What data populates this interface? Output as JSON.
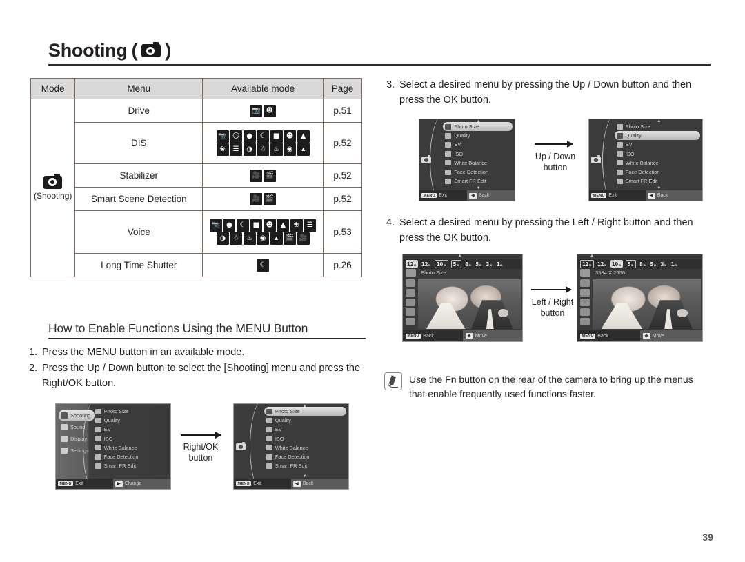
{
  "header": {
    "title": "Shooting",
    "title_icon": "camera-icon",
    "open_paren": "(",
    "close_paren": ")"
  },
  "mode_table": {
    "columns": [
      "Mode",
      "Menu",
      "Available mode",
      "Page"
    ],
    "mode_cell": {
      "icon": "camera-icon",
      "label": "(Shooting)"
    },
    "rows": [
      {
        "menu": "Drive",
        "page": "p.51",
        "icons": [
          "program",
          "portrait"
        ]
      },
      {
        "menu": "DIS",
        "page": "p.52",
        "icons": [
          "program",
          "beauty-shot",
          "frame-guide",
          "night",
          "portrait",
          "children",
          "landscape",
          "close-up",
          "text",
          "sunset",
          "dawn",
          "backlight",
          "fireworks",
          "beach-snow"
        ]
      },
      {
        "menu": "Stabilizer",
        "page": "p.52",
        "icons": [
          "movie-smart",
          "movie"
        ]
      },
      {
        "menu": "Smart Scene Detection",
        "page": "p.52",
        "icons": [
          "movie-smart",
          "movie"
        ]
      },
      {
        "menu": "Voice",
        "page": "p.53",
        "icons": [
          "program",
          "frame-guide",
          "night",
          "portrait",
          "children",
          "landscape",
          "close-up",
          "text",
          "sunset",
          "dawn",
          "backlight",
          "fireworks",
          "beach-snow",
          "movie",
          "movie-smart"
        ]
      },
      {
        "menu": "Long Time Shutter",
        "page": "p.26",
        "icons": [
          "night"
        ]
      }
    ]
  },
  "section": {
    "heading": "How to Enable Functions Using the MENU Button",
    "steps": [
      {
        "num": "1.",
        "text": "Press the MENU button in an available mode."
      },
      {
        "num": "2.",
        "text": "Press the Up / Down button to select the [Shooting] menu and press the Right/OK button."
      }
    ]
  },
  "right_steps": [
    {
      "num": "3.",
      "text": "Select a desired menu by pressing the Up / Down button and then press the OK button."
    },
    {
      "num": "4.",
      "text": "Select a desired menu by pressing the Left / Right button and then press the OK button."
    }
  ],
  "arrow_labels": {
    "right_ok": "Right/OK\nbutton",
    "right_ok_line1": "Right/OK",
    "right_ok_line2": "button",
    "up_down_line1": "Up / Down",
    "up_down_line2": "button",
    "left_right_line1": "Left / Right",
    "left_right_line2": "button"
  },
  "lcd": {
    "main_menu_tabs": [
      {
        "label": "Shooting",
        "icon": "camera-icon",
        "selected": true
      },
      {
        "label": "Sound",
        "icon": "speaker-icon",
        "selected": false
      },
      {
        "label": "Display",
        "icon": "display-icon",
        "selected": false
      },
      {
        "label": "Settings",
        "icon": "gear-icon",
        "selected": false
      }
    ],
    "shooting_items": [
      {
        "label": "Photo Size",
        "icon": "photo-size-icon"
      },
      {
        "label": "Quality",
        "icon": "quality-icon"
      },
      {
        "label": "EV",
        "icon": "ev-icon"
      },
      {
        "label": "ISO",
        "icon": "iso-icon"
      },
      {
        "label": "White Balance",
        "icon": "white-balance-icon"
      },
      {
        "label": "Face Detection",
        "icon": "face-detection-icon"
      },
      {
        "label": "Smart FR Edit",
        "icon": "smart-fr-edit-icon"
      }
    ],
    "screen1": {
      "selected_tab": "Shooting",
      "exit_label": "Exit",
      "exit_key": "MENU",
      "action_label": "Change",
      "action_key": "▶"
    },
    "screen2": {
      "selected_item": "Photo Size",
      "exit_label": "Exit",
      "exit_key": "MENU",
      "action_label": "Back",
      "action_key": "◀"
    },
    "screen3": {
      "selected_item": "Photo Size",
      "exit_label": "Exit",
      "exit_key": "MENU",
      "action_label": "Back",
      "action_key": "◀"
    },
    "screen4": {
      "selected_item": "Quality",
      "exit_label": "Exit",
      "exit_key": "MENU",
      "action_label": "Back",
      "action_key": "◀"
    },
    "photo_size": {
      "chips": [
        "12ₘ",
        "12ₘ",
        "10ₘ",
        "5ₘ",
        "8ₘ",
        "5ₘ",
        "3ₘ",
        "1ₘ"
      ],
      "screen5": {
        "selected_index": 0,
        "label": "Photo Size",
        "back_label": "Back",
        "back_key": "MENU",
        "move_label": "Move",
        "move_key": "✥"
      },
      "screen6": {
        "selected_index": 2,
        "label": "3984 X 2656",
        "back_label": "Back",
        "back_key": "MENU",
        "move_label": "Move",
        "move_key": "✥"
      }
    }
  },
  "note": {
    "icon": "pencil-note-icon",
    "text": "Use the Fn button on the rear of the camera to bring up the menus that enable frequently used functions faster."
  },
  "footer": {
    "page_number": "39"
  }
}
